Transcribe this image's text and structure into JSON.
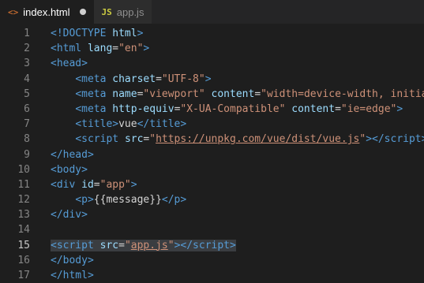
{
  "tabs": [
    {
      "label": "index.html",
      "icon_text": "<>",
      "icon": "html-file-icon",
      "active": true,
      "modified": true
    },
    {
      "label": "app.js",
      "icon_text": "JS",
      "icon": "js-file-icon",
      "active": false,
      "modified": false
    }
  ],
  "editor": {
    "current_line": 15,
    "lines": [
      {
        "n": "1",
        "segs": [
          [
            "tag",
            "<!DOCTYPE "
          ],
          [
            "attr",
            "html"
          ],
          [
            "tag",
            ">"
          ]
        ]
      },
      {
        "n": "2",
        "segs": [
          [
            "punct",
            "<"
          ],
          [
            "tag",
            "html "
          ],
          [
            "attr",
            "lang"
          ],
          [
            "txt",
            "="
          ],
          [
            "str",
            "\"en\""
          ],
          [
            "punct",
            ">"
          ]
        ]
      },
      {
        "n": "3",
        "segs": [
          [
            "punct",
            "<"
          ],
          [
            "tag",
            "head"
          ],
          [
            "punct",
            ">"
          ]
        ]
      },
      {
        "n": "4",
        "segs": [
          [
            "txt",
            "    "
          ],
          [
            "punct",
            "<"
          ],
          [
            "tag",
            "meta "
          ],
          [
            "attr",
            "charset"
          ],
          [
            "txt",
            "="
          ],
          [
            "str",
            "\"UTF-8\""
          ],
          [
            "punct",
            ">"
          ]
        ]
      },
      {
        "n": "5",
        "segs": [
          [
            "txt",
            "    "
          ],
          [
            "punct",
            "<"
          ],
          [
            "tag",
            "meta "
          ],
          [
            "attr",
            "name"
          ],
          [
            "txt",
            "="
          ],
          [
            "str",
            "\"viewport\""
          ],
          [
            "txt",
            " "
          ],
          [
            "attr",
            "content"
          ],
          [
            "txt",
            "="
          ],
          [
            "str",
            "\"width=device-width, initial"
          ]
        ]
      },
      {
        "n": "6",
        "segs": [
          [
            "txt",
            "    "
          ],
          [
            "punct",
            "<"
          ],
          [
            "tag",
            "meta "
          ],
          [
            "attr",
            "http-equiv"
          ],
          [
            "txt",
            "="
          ],
          [
            "str",
            "\"X-UA-Compatible\""
          ],
          [
            "txt",
            " "
          ],
          [
            "attr",
            "content"
          ],
          [
            "txt",
            "="
          ],
          [
            "str",
            "\"ie=edge\""
          ],
          [
            "punct",
            ">"
          ]
        ]
      },
      {
        "n": "7",
        "segs": [
          [
            "txt",
            "    "
          ],
          [
            "punct",
            "<"
          ],
          [
            "tag",
            "title"
          ],
          [
            "punct",
            ">"
          ],
          [
            "txt",
            "vue"
          ],
          [
            "punct",
            "</"
          ],
          [
            "tag",
            "title"
          ],
          [
            "punct",
            ">"
          ]
        ]
      },
      {
        "n": "8",
        "segs": [
          [
            "txt",
            "    "
          ],
          [
            "punct",
            "<"
          ],
          [
            "tag",
            "script "
          ],
          [
            "attr",
            "src"
          ],
          [
            "txt",
            "="
          ],
          [
            "str",
            "\""
          ],
          [
            "link",
            "https://unpkg.com/vue/dist/vue.js"
          ],
          [
            "str",
            "\""
          ],
          [
            "punct",
            "></"
          ],
          [
            "tag",
            "script"
          ],
          [
            "punct",
            ">"
          ]
        ]
      },
      {
        "n": "9",
        "segs": [
          [
            "punct",
            "</"
          ],
          [
            "tag",
            "head"
          ],
          [
            "punct",
            ">"
          ]
        ]
      },
      {
        "n": "10",
        "segs": [
          [
            "punct",
            "<"
          ],
          [
            "tag",
            "body"
          ],
          [
            "punct",
            ">"
          ]
        ]
      },
      {
        "n": "11",
        "segs": [
          [
            "punct",
            "<"
          ],
          [
            "tag",
            "div "
          ],
          [
            "attr",
            "id"
          ],
          [
            "txt",
            "="
          ],
          [
            "str",
            "\"app\""
          ],
          [
            "punct",
            ">"
          ]
        ]
      },
      {
        "n": "12",
        "segs": [
          [
            "txt",
            "    "
          ],
          [
            "punct",
            "<"
          ],
          [
            "tag",
            "p"
          ],
          [
            "punct",
            ">"
          ],
          [
            "txt",
            "{{message}}"
          ],
          [
            "punct",
            "</"
          ],
          [
            "tag",
            "p"
          ],
          [
            "punct",
            ">"
          ]
        ]
      },
      {
        "n": "13",
        "segs": [
          [
            "punct",
            "</"
          ],
          [
            "tag",
            "div"
          ],
          [
            "punct",
            ">"
          ]
        ]
      },
      {
        "n": "14",
        "segs": []
      },
      {
        "n": "15",
        "segs": [
          [
            "punct",
            "<"
          ],
          [
            "tag",
            "script "
          ],
          [
            "attr",
            "src"
          ],
          [
            "txt",
            "="
          ],
          [
            "str",
            "\""
          ],
          [
            "link",
            "app.js"
          ],
          [
            "str",
            "\""
          ],
          [
            "punct",
            "></"
          ],
          [
            "tag",
            "script"
          ],
          [
            "punct",
            ">"
          ]
        ]
      },
      {
        "n": "16",
        "segs": [
          [
            "punct",
            "</"
          ],
          [
            "tag",
            "body"
          ],
          [
            "punct",
            ">"
          ]
        ]
      },
      {
        "n": "17",
        "segs": [
          [
            "punct",
            "</"
          ],
          [
            "tag",
            "html"
          ],
          [
            "punct",
            ">"
          ]
        ]
      }
    ]
  },
  "colors": {
    "background": "#1e1e1e",
    "tag": "#569cd6",
    "attribute": "#9cdcfe",
    "string": "#ce9178",
    "line_number": "#858585"
  }
}
